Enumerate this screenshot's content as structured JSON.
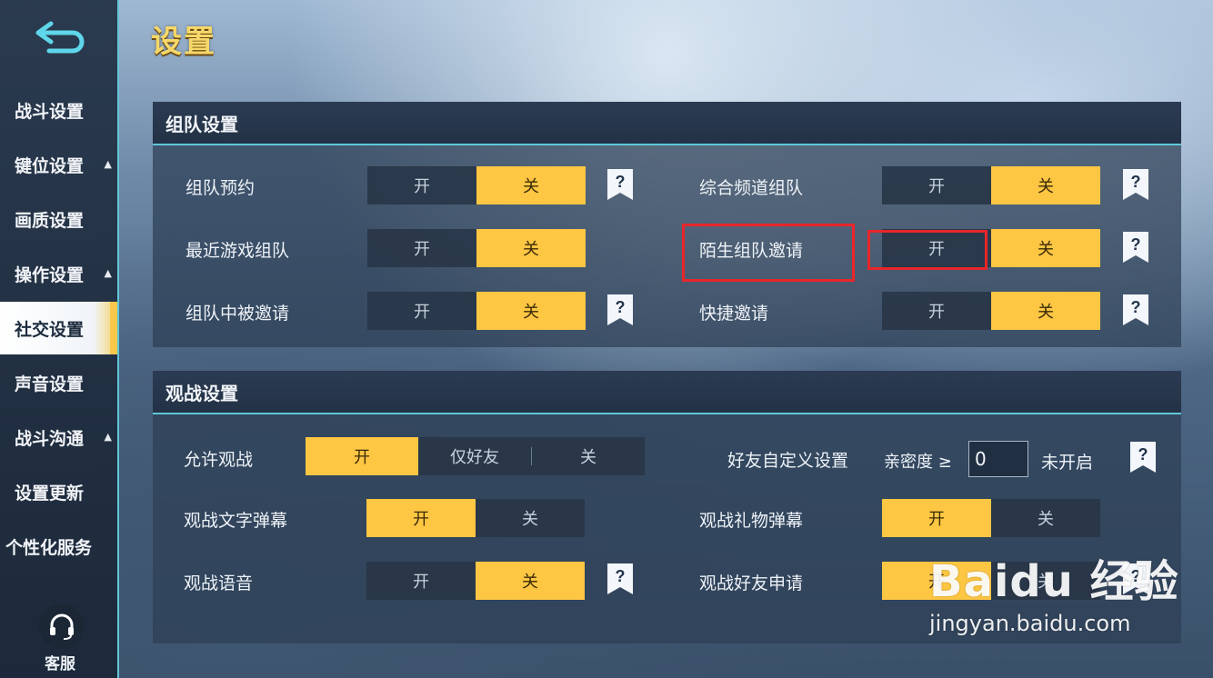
{
  "page_title": "设置",
  "sidebar": {
    "items": [
      {
        "label": "战斗设置",
        "arrow": ""
      },
      {
        "label": "键位设置",
        "arrow": "▲"
      },
      {
        "label": "画质设置",
        "arrow": ""
      },
      {
        "label": "操作设置",
        "arrow": "▲"
      },
      {
        "label": "社交设置",
        "arrow": ""
      },
      {
        "label": "声音设置",
        "arrow": ""
      },
      {
        "label": "战斗沟通",
        "arrow": "▲"
      },
      {
        "label": "设置更新",
        "arrow": ""
      },
      {
        "label": "个性化服务",
        "arrow": ""
      }
    ],
    "active_index": 4,
    "service_label": "客服"
  },
  "team": {
    "title": "组队设置",
    "rows": [
      {
        "label": "组队预约",
        "on": "开",
        "off": "关",
        "selected": "关",
        "help": true
      },
      {
        "label": "综合频道组队",
        "on": "开",
        "off": "关",
        "selected": "关",
        "help": true
      },
      {
        "label": "最近游戏组队",
        "on": "开",
        "off": "关",
        "selected": "关",
        "help": false
      },
      {
        "label": "陌生组队邀请",
        "on": "开",
        "off": "关",
        "selected": "关",
        "help": true
      },
      {
        "label": "组队中被邀请",
        "on": "开",
        "off": "关",
        "selected": "关",
        "help": true
      },
      {
        "label": "快捷邀请",
        "on": "开",
        "off": "关",
        "selected": "关",
        "help": true
      }
    ]
  },
  "spectate": {
    "title": "观战设置",
    "allow": {
      "label": "允许观战",
      "options": [
        "开",
        "仅好友",
        "关"
      ],
      "selected": "开"
    },
    "friend_custom": {
      "label": "好友自定义设置",
      "intimacy_label": "亲密度 ≥",
      "intimacy_value": "0",
      "status": "未开启"
    },
    "rows": [
      {
        "label": "观战文字弹幕",
        "on": "开",
        "off": "关",
        "selected": "开"
      },
      {
        "label": "观战礼物弹幕",
        "on": "开",
        "off": "关",
        "selected": "开"
      },
      {
        "label": "观战语音",
        "on": "开",
        "off": "关",
        "selected": "关"
      },
      {
        "label": "观战好友申请",
        "on": "开",
        "off": "关",
        "selected": "开"
      }
    ]
  },
  "watermark": {
    "top": "Baidu 经验",
    "bottom": "jingyan.baidu.com"
  },
  "colors": {
    "accent": "#fdc643",
    "cyan": "#5fc7d9",
    "highlight": "#e8262a"
  }
}
